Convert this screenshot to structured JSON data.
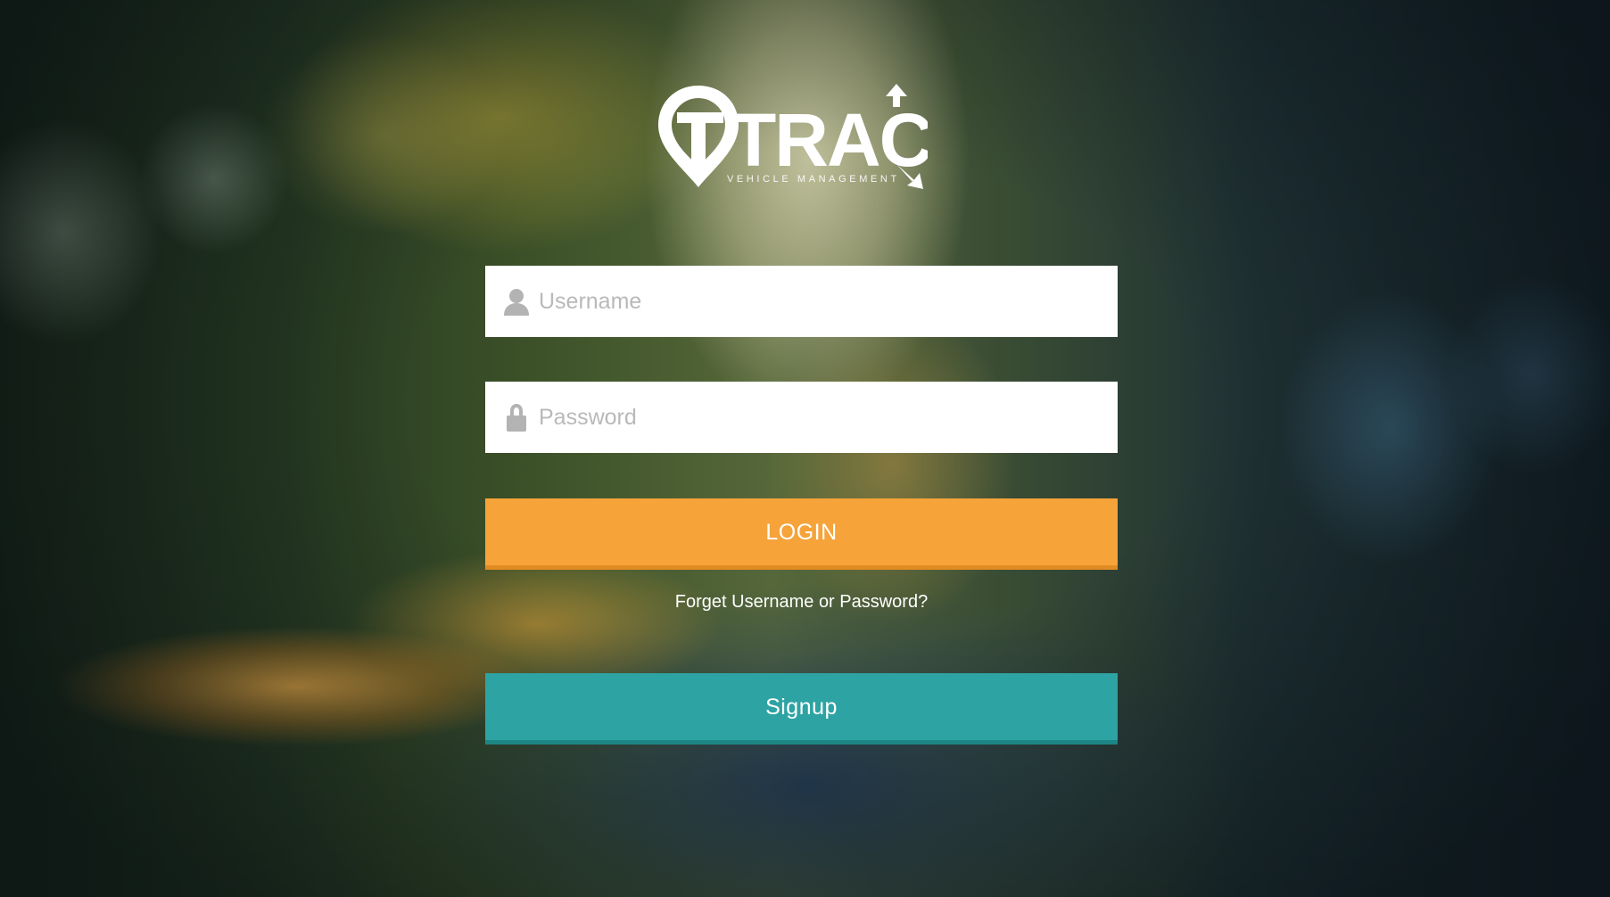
{
  "logo": {
    "wordmark": "TRACK",
    "tagline": "VEHICLE MANAGEMENT",
    "icon": "map-pin-icon"
  },
  "form": {
    "username": {
      "placeholder": "Username",
      "value": "",
      "icon": "user-icon"
    },
    "password": {
      "placeholder": "Password",
      "value": "",
      "icon": "lock-icon"
    },
    "login_label": "LOGIN",
    "forgot_label": "Forget Username or Password?",
    "signup_label": "Signup"
  },
  "colors": {
    "login": "#f6a33a",
    "signup": "#2ea3a3",
    "field_background": "#ffffff",
    "placeholder": "#b9b9b9"
  }
}
